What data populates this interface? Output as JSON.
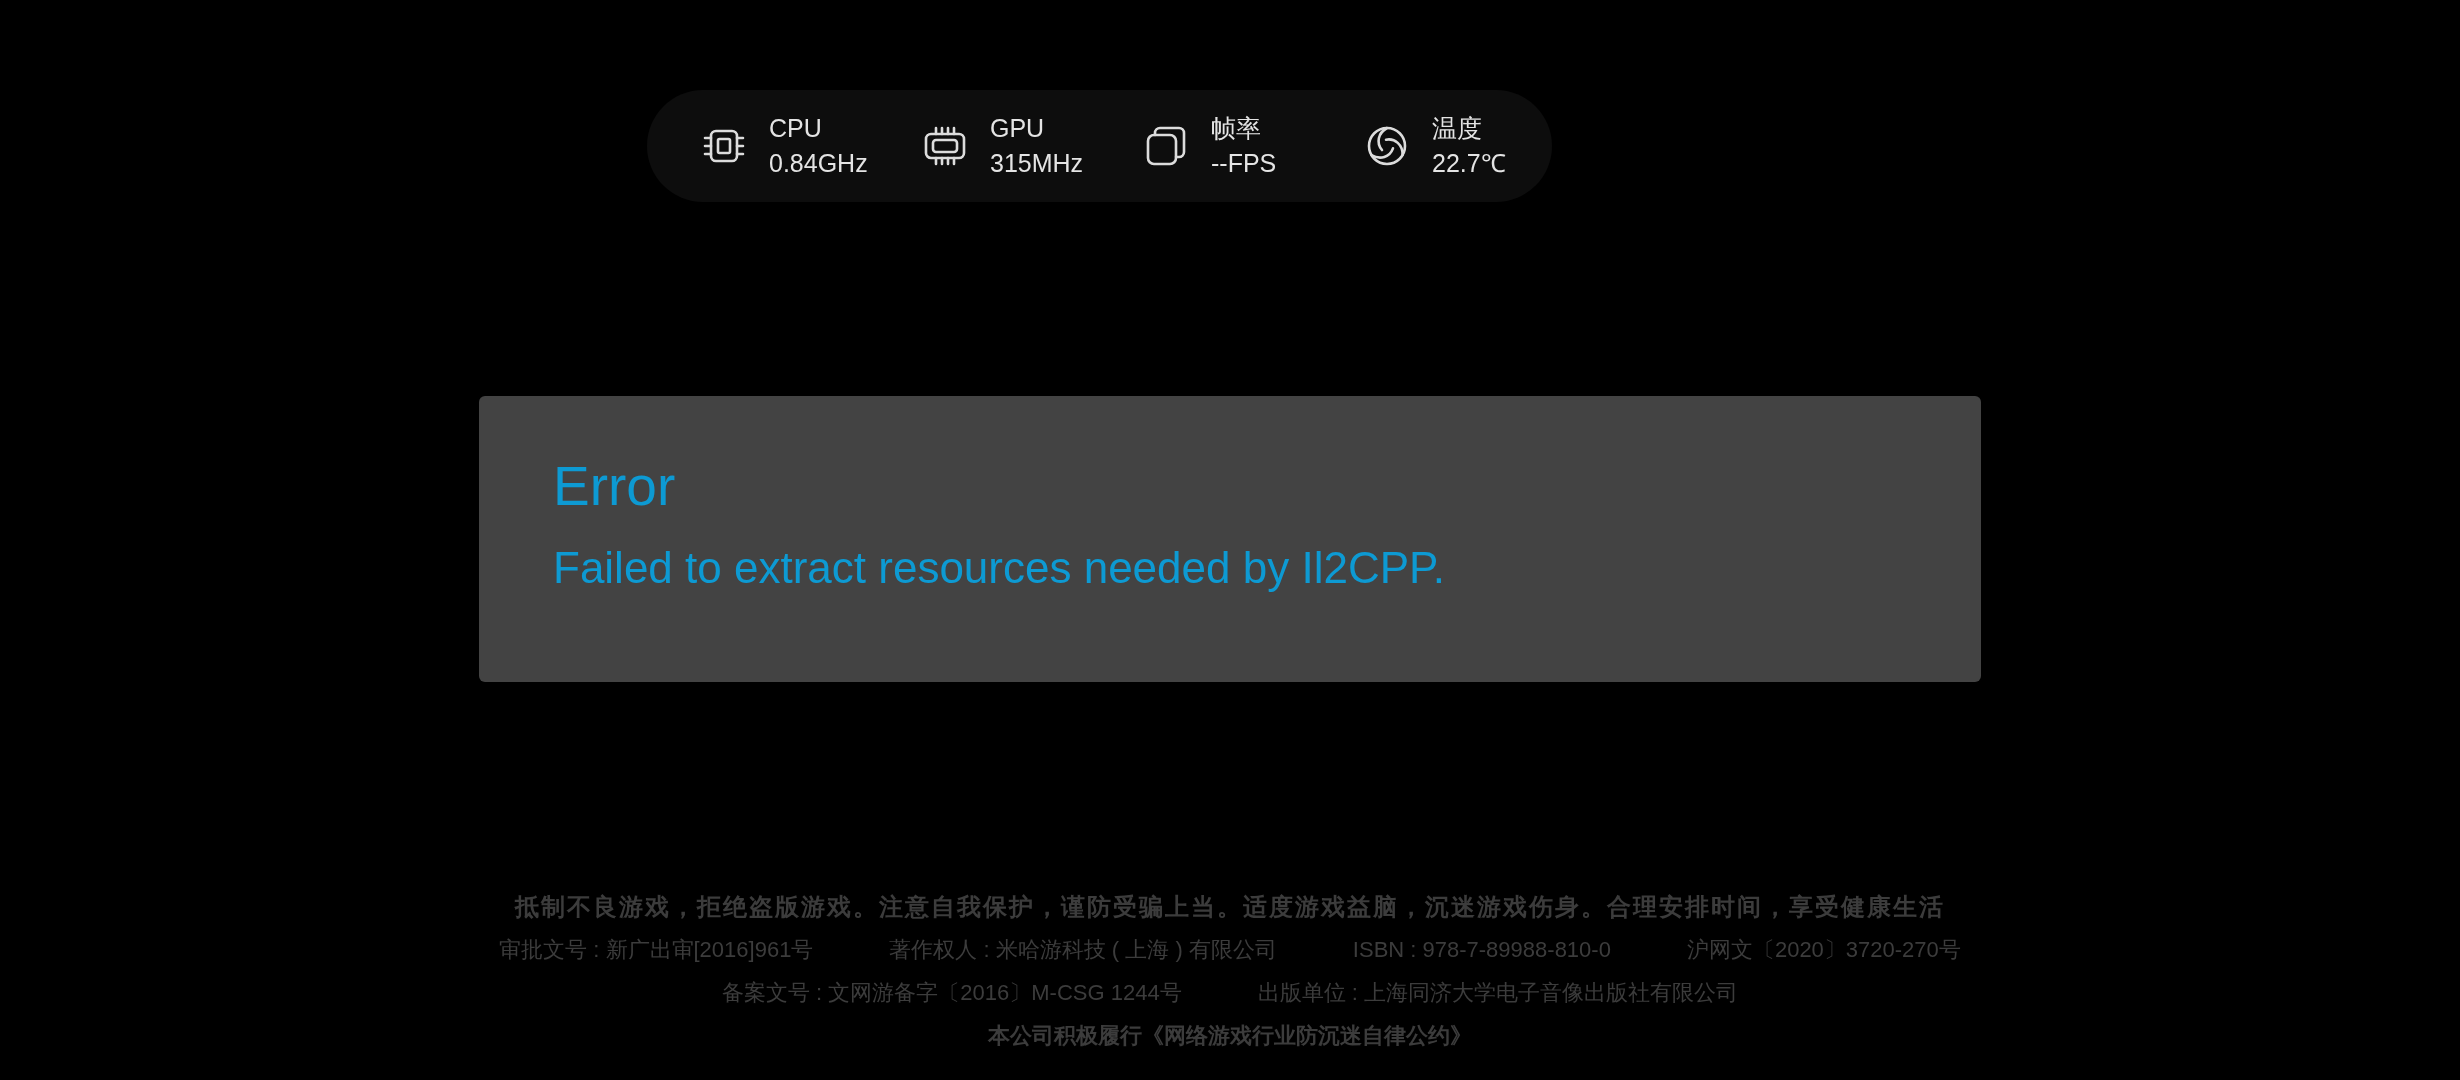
{
  "stats_bar": {
    "items": [
      {
        "kind": "cpu",
        "label": "CPU",
        "value": "0.84GHz"
      },
      {
        "kind": "gpu",
        "label": "GPU",
        "value": "315MHz"
      },
      {
        "kind": "fps",
        "label": "帧率",
        "value": "--FPS"
      },
      {
        "kind": "temperature",
        "label": "温度",
        "value": "22.7℃"
      }
    ]
  },
  "error_dialog": {
    "title": "Error",
    "message": "Failed to extract resources needed by Il2CPP."
  },
  "footer": {
    "lines": [
      [
        "抵制不良游戏，拒绝盗版游戏。注意自我保护，谨防受骗上当。适度游戏益脑，沉迷游戏伤身。合理安排时间，享受健康生活"
      ],
      [
        "审批文号 : 新广出审[2016]961号",
        "著作权人 : 米哈游科技 ( 上海 ) 有限公司",
        "ISBN : 978-7-89988-810-0",
        "沪网文〔2020〕3720-270号"
      ],
      [
        "备案文号 : 文网游备字〔2016〕M-CSG 1244号",
        "出版单位 : 上海同济大学电子音像出版社有限公司"
      ],
      [
        "本公司积极履行《网络游戏行业防沉迷自律公约》"
      ]
    ]
  }
}
